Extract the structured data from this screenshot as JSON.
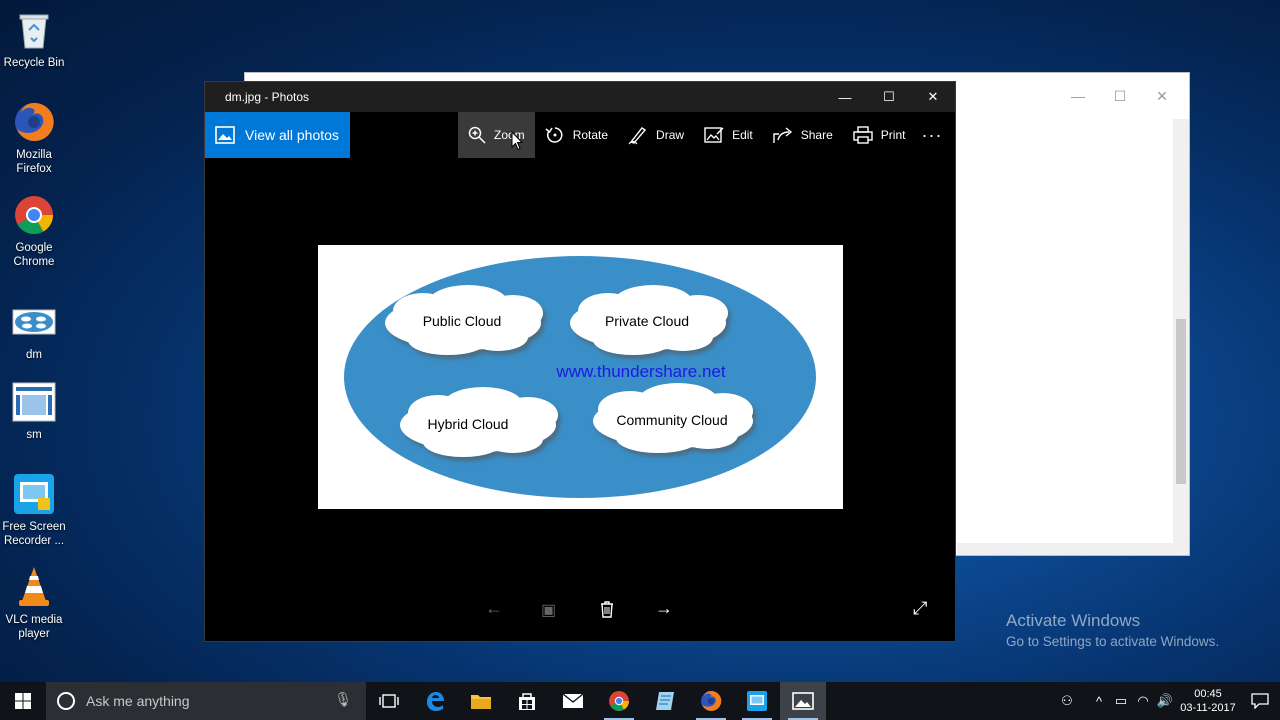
{
  "desktop": {
    "icons": [
      {
        "label": "Recycle Bin"
      },
      {
        "label": "Mozilla Firefox"
      },
      {
        "label": "Google Chrome"
      },
      {
        "label": "dm"
      },
      {
        "label": "sm"
      },
      {
        "label": "Free Screen Recorder ..."
      },
      {
        "label": "VLC media player"
      }
    ]
  },
  "photos_window": {
    "title": "dm.jpg - Photos",
    "view_all_label": "View all photos",
    "tools": [
      "Zoom",
      "Rotate",
      "Draw",
      "Edit",
      "Share",
      "Print"
    ],
    "more_label": "···"
  },
  "image": {
    "ellipse_color": "#3a8fc8",
    "clouds": [
      "Public Cloud",
      "Private Cloud",
      "Hybrid Cloud",
      "Community Cloud"
    ],
    "url_text": "www.thundershare.net",
    "url_color": "#1a1ae6"
  },
  "watermark": {
    "line1": "Activate Windows",
    "line2": "Go to Settings to activate Windows."
  },
  "taskbar": {
    "search_placeholder": "Ask me anything",
    "time": "00:45",
    "date": "03-11-2017"
  }
}
